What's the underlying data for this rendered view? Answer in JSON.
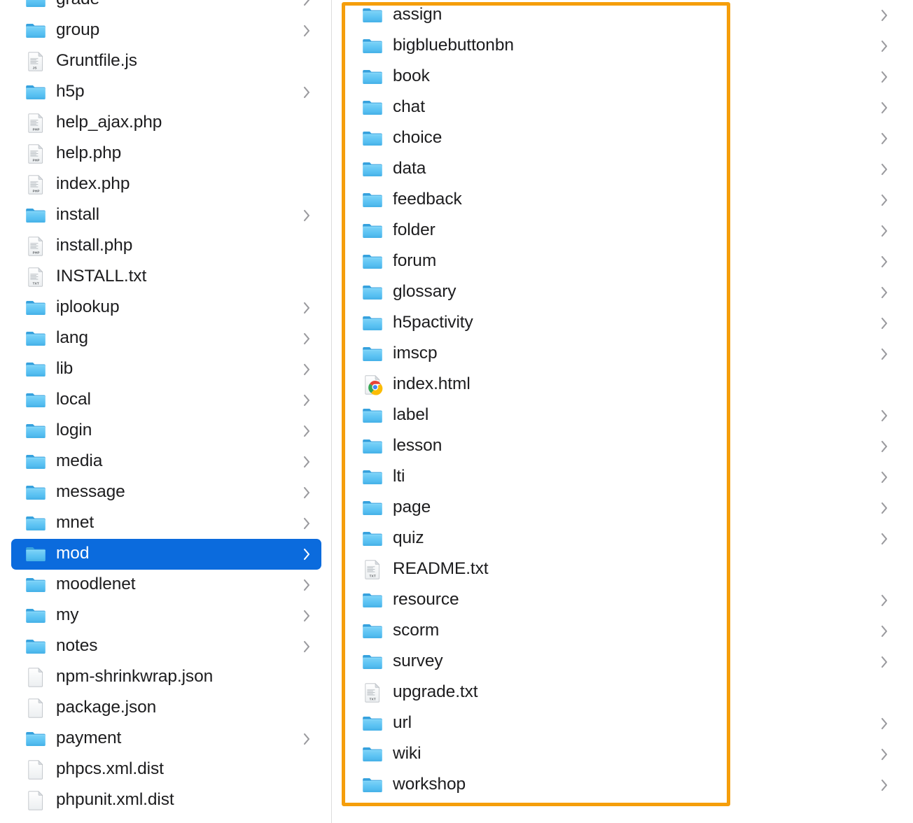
{
  "colors": {
    "selection_blue": "#0b6bdd",
    "highlight_orange": "#f59e0b",
    "folder_blue": "#54c0f4",
    "text": "#1d1d1f",
    "chevron_gray": "#9a9a9e"
  },
  "columns": {
    "left": {
      "name": "moodle-root-directory-column",
      "items": [
        {
          "label": "grade",
          "icon": "folder-icon",
          "has_chevron": true,
          "selected": false,
          "partial_top": true
        },
        {
          "label": "group",
          "icon": "folder-icon",
          "has_chevron": true,
          "selected": false
        },
        {
          "label": "Gruntfile.js",
          "icon": "js-file-icon",
          "has_chevron": false,
          "selected": false
        },
        {
          "label": "h5p",
          "icon": "folder-icon",
          "has_chevron": true,
          "selected": false
        },
        {
          "label": "help_ajax.php",
          "icon": "php-file-icon",
          "has_chevron": false,
          "selected": false
        },
        {
          "label": "help.php",
          "icon": "php-file-icon",
          "has_chevron": false,
          "selected": false
        },
        {
          "label": "index.php",
          "icon": "php-file-icon",
          "has_chevron": false,
          "selected": false
        },
        {
          "label": "install",
          "icon": "folder-icon",
          "has_chevron": true,
          "selected": false
        },
        {
          "label": "install.php",
          "icon": "php-file-icon",
          "has_chevron": false,
          "selected": false
        },
        {
          "label": "INSTALL.txt",
          "icon": "txt-file-icon",
          "has_chevron": false,
          "selected": false
        },
        {
          "label": "iplookup",
          "icon": "folder-icon",
          "has_chevron": true,
          "selected": false
        },
        {
          "label": "lang",
          "icon": "folder-icon",
          "has_chevron": true,
          "selected": false
        },
        {
          "label": "lib",
          "icon": "folder-icon",
          "has_chevron": true,
          "selected": false
        },
        {
          "label": "local",
          "icon": "folder-icon",
          "has_chevron": true,
          "selected": false
        },
        {
          "label": "login",
          "icon": "folder-icon",
          "has_chevron": true,
          "selected": false
        },
        {
          "label": "media",
          "icon": "folder-icon",
          "has_chevron": true,
          "selected": false
        },
        {
          "label": "message",
          "icon": "folder-icon",
          "has_chevron": true,
          "selected": false
        },
        {
          "label": "mnet",
          "icon": "folder-icon",
          "has_chevron": true,
          "selected": false
        },
        {
          "label": "mod",
          "icon": "folder-icon",
          "has_chevron": true,
          "selected": true
        },
        {
          "label": "moodlenet",
          "icon": "folder-icon",
          "has_chevron": true,
          "selected": false
        },
        {
          "label": "my",
          "icon": "folder-icon",
          "has_chevron": true,
          "selected": false
        },
        {
          "label": "notes",
          "icon": "folder-icon",
          "has_chevron": true,
          "selected": false
        },
        {
          "label": "npm-shrinkwrap.json",
          "icon": "generic-file-icon",
          "has_chevron": false,
          "selected": false
        },
        {
          "label": "package.json",
          "icon": "generic-file-icon",
          "has_chevron": false,
          "selected": false
        },
        {
          "label": "payment",
          "icon": "folder-icon",
          "has_chevron": true,
          "selected": false
        },
        {
          "label": "phpcs.xml.dist",
          "icon": "generic-file-icon",
          "has_chevron": false,
          "selected": false
        },
        {
          "label": "phpunit.xml.dist",
          "icon": "generic-file-icon",
          "has_chevron": false,
          "selected": false
        }
      ]
    },
    "right": {
      "name": "mod-directory-column",
      "items": [
        {
          "label": "assign",
          "icon": "folder-icon",
          "has_chevron": true,
          "selected": false
        },
        {
          "label": "bigbluebuttonbn",
          "icon": "folder-icon",
          "has_chevron": true,
          "selected": false
        },
        {
          "label": "book",
          "icon": "folder-icon",
          "has_chevron": true,
          "selected": false
        },
        {
          "label": "chat",
          "icon": "folder-icon",
          "has_chevron": true,
          "selected": false
        },
        {
          "label": "choice",
          "icon": "folder-icon",
          "has_chevron": true,
          "selected": false
        },
        {
          "label": "data",
          "icon": "folder-icon",
          "has_chevron": true,
          "selected": false
        },
        {
          "label": "feedback",
          "icon": "folder-icon",
          "has_chevron": true,
          "selected": false
        },
        {
          "label": "folder",
          "icon": "folder-icon",
          "has_chevron": true,
          "selected": false
        },
        {
          "label": "forum",
          "icon": "folder-icon",
          "has_chevron": true,
          "selected": false
        },
        {
          "label": "glossary",
          "icon": "folder-icon",
          "has_chevron": true,
          "selected": false
        },
        {
          "label": "h5pactivity",
          "icon": "folder-icon",
          "has_chevron": true,
          "selected": false
        },
        {
          "label": "imscp",
          "icon": "folder-icon",
          "has_chevron": true,
          "selected": false
        },
        {
          "label": "index.html",
          "icon": "chrome-html-file-icon",
          "has_chevron": false,
          "selected": false
        },
        {
          "label": "label",
          "icon": "folder-icon",
          "has_chevron": true,
          "selected": false
        },
        {
          "label": "lesson",
          "icon": "folder-icon",
          "has_chevron": true,
          "selected": false
        },
        {
          "label": "lti",
          "icon": "folder-icon",
          "has_chevron": true,
          "selected": false
        },
        {
          "label": "page",
          "icon": "folder-icon",
          "has_chevron": true,
          "selected": false
        },
        {
          "label": "quiz",
          "icon": "folder-icon",
          "has_chevron": true,
          "selected": false
        },
        {
          "label": "README.txt",
          "icon": "txt-file-icon",
          "has_chevron": false,
          "selected": false
        },
        {
          "label": "resource",
          "icon": "folder-icon",
          "has_chevron": true,
          "selected": false
        },
        {
          "label": "scorm",
          "icon": "folder-icon",
          "has_chevron": true,
          "selected": false
        },
        {
          "label": "survey",
          "icon": "folder-icon",
          "has_chevron": true,
          "selected": false
        },
        {
          "label": "upgrade.txt",
          "icon": "txt-file-icon",
          "has_chevron": false,
          "selected": false
        },
        {
          "label": "url",
          "icon": "folder-icon",
          "has_chevron": true,
          "selected": false
        },
        {
          "label": "wiki",
          "icon": "folder-icon",
          "has_chevron": true,
          "selected": false
        },
        {
          "label": "workshop",
          "icon": "folder-icon",
          "has_chevron": true,
          "selected": false
        }
      ]
    }
  },
  "annotation": {
    "name": "orange-highlight-box",
    "color": "#f59e0b"
  }
}
